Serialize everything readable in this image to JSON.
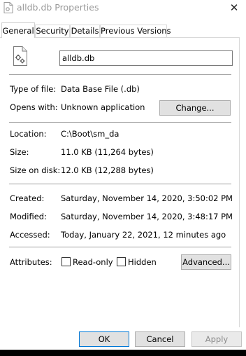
{
  "window": {
    "title": "alldb.db Properties",
    "close_glyph": "✕"
  },
  "tabs": [
    {
      "label": "General",
      "active": true
    },
    {
      "label": "Security",
      "active": false
    },
    {
      "label": "Details",
      "active": false
    },
    {
      "label": "Previous Versions",
      "active": false
    }
  ],
  "file": {
    "name": "alldb.db",
    "icon": "file-settings-icon"
  },
  "type_row": {
    "label": "Type of file:",
    "value": "Data Base File (.db)"
  },
  "opens_row": {
    "label": "Opens with:",
    "value": "Unknown application",
    "button": "Change..."
  },
  "location_row": {
    "label": "Location:",
    "value": "C:\\Boot\\sm_da"
  },
  "size_row": {
    "label": "Size:",
    "value": "11.0 KB (11,264 bytes)"
  },
  "size_disk_row": {
    "label": "Size on disk:",
    "value": "12.0 KB (12,288 bytes)"
  },
  "created_row": {
    "label": "Created:",
    "value": "Saturday, November 14, 2020, 3:50:02 PM"
  },
  "modified_row": {
    "label": "Modified:",
    "value": "Saturday, November 14, 2020, 3:48:17 PM"
  },
  "accessed_row": {
    "label": "Accessed:",
    "value": "Today, January 22, 2021, 12 minutes ago"
  },
  "attributes": {
    "label": "Attributes:",
    "readonly_label": "Read-only",
    "readonly_checked": false,
    "hidden_label": "Hidden",
    "hidden_checked": false,
    "advanced_button": "Advanced..."
  },
  "footer": {
    "ok": "OK",
    "cancel": "Cancel",
    "apply": "Apply"
  }
}
